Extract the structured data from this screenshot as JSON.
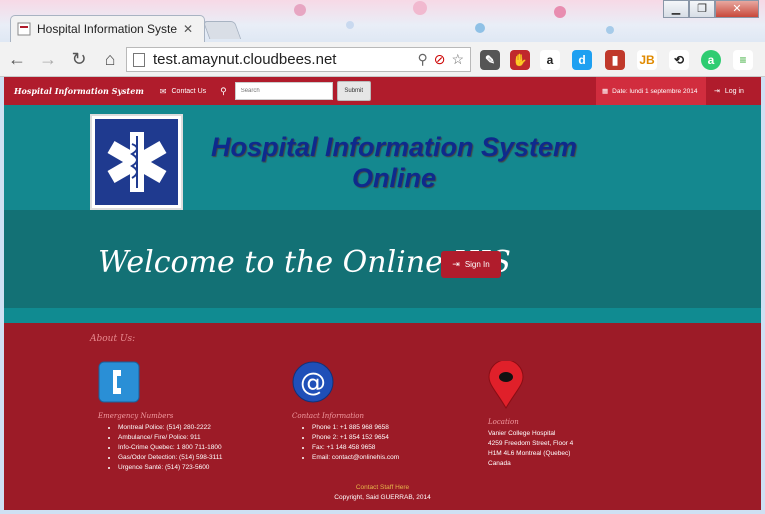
{
  "browser": {
    "tab_title": "Hospital Information System",
    "url": "test.amaynut.cloudbees.net"
  },
  "navbar": {
    "brand": "Hospital Information System",
    "contact_us": "Contact Us",
    "search_placeholder": "Search",
    "submit_label": "Submit",
    "date": "Date: lundi 1 septembre 2014",
    "login": "Log in"
  },
  "hero": {
    "title_line1": "Hospital Information System",
    "title_line2": "Online",
    "welcome": "Welcome to the Online HIS",
    "signin_label": "Sign In"
  },
  "footer": {
    "about": "About Us:",
    "emergency": {
      "heading": "Emergency Numbers",
      "items": [
        "Montreal Police: (514) 280-2222",
        "Ambulance/ Fire/ Police: 911",
        "Info-Crime Quebec: 1 800 711-1800",
        "Gas/Odor Detection: (514) 598-3111",
        "Urgence Santé: (514) 723-5600"
      ]
    },
    "contact": {
      "heading": "Contact Information",
      "items": [
        "Phone 1: +1 885 968 9658",
        "Phone 2: +1 854 152 9654",
        "Fax: +1 148 458 9658",
        "Email: contact@onlinehis.com"
      ]
    },
    "location": {
      "heading": "Location",
      "lines": [
        "Vanier College Hospital",
        "4259 Freedom Street, Floor 4",
        "H1M 4L6 Montreal (Quebec)",
        "Canada"
      ]
    },
    "contact_staff": "Contact Staff Here",
    "copyright": "Copyright, Said GUERRAB, 2014"
  },
  "colors": {
    "navbar": "#b01c2c",
    "teal": "#14888f",
    "teal_dark": "#137175",
    "footer": "#9c1b27",
    "title_blue": "#0e2a8c"
  }
}
